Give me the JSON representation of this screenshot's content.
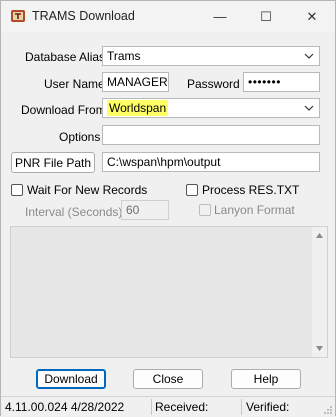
{
  "window": {
    "title": "TRAMS Download",
    "minimize_glyph": "—",
    "maximize_glyph": "☐",
    "close_glyph": "✕"
  },
  "form": {
    "database_alias": {
      "label": "Database Alias",
      "value": "Trams"
    },
    "user_name": {
      "label": "User Name",
      "value": "MANAGER"
    },
    "password": {
      "label": "Password",
      "value": "•••••••"
    },
    "download_from": {
      "label": "Download From",
      "value": "Worldspan"
    },
    "options": {
      "label": "Options",
      "value": ""
    },
    "pnr_file_path": {
      "button_label": "PNR File Path",
      "value": "C:\\wspan\\hpm\\output"
    },
    "wait_for_new_records": {
      "label": "Wait For New Records",
      "checked": false
    },
    "process_res_txt": {
      "label": "Process RES.TXT",
      "checked": false
    },
    "interval": {
      "label": "Interval (Seconds)",
      "value": "60"
    },
    "lanyon_format": {
      "label": "Lanyon Format",
      "checked": false
    }
  },
  "buttons": {
    "download": "Download",
    "close": "Close",
    "help": "Help"
  },
  "status": {
    "version": "4.11.00.024 4/28/2022",
    "received": "Received:",
    "verified": "Verified:"
  },
  "colors": {
    "highlight": "#ffff66",
    "accent": "#0067c0"
  }
}
